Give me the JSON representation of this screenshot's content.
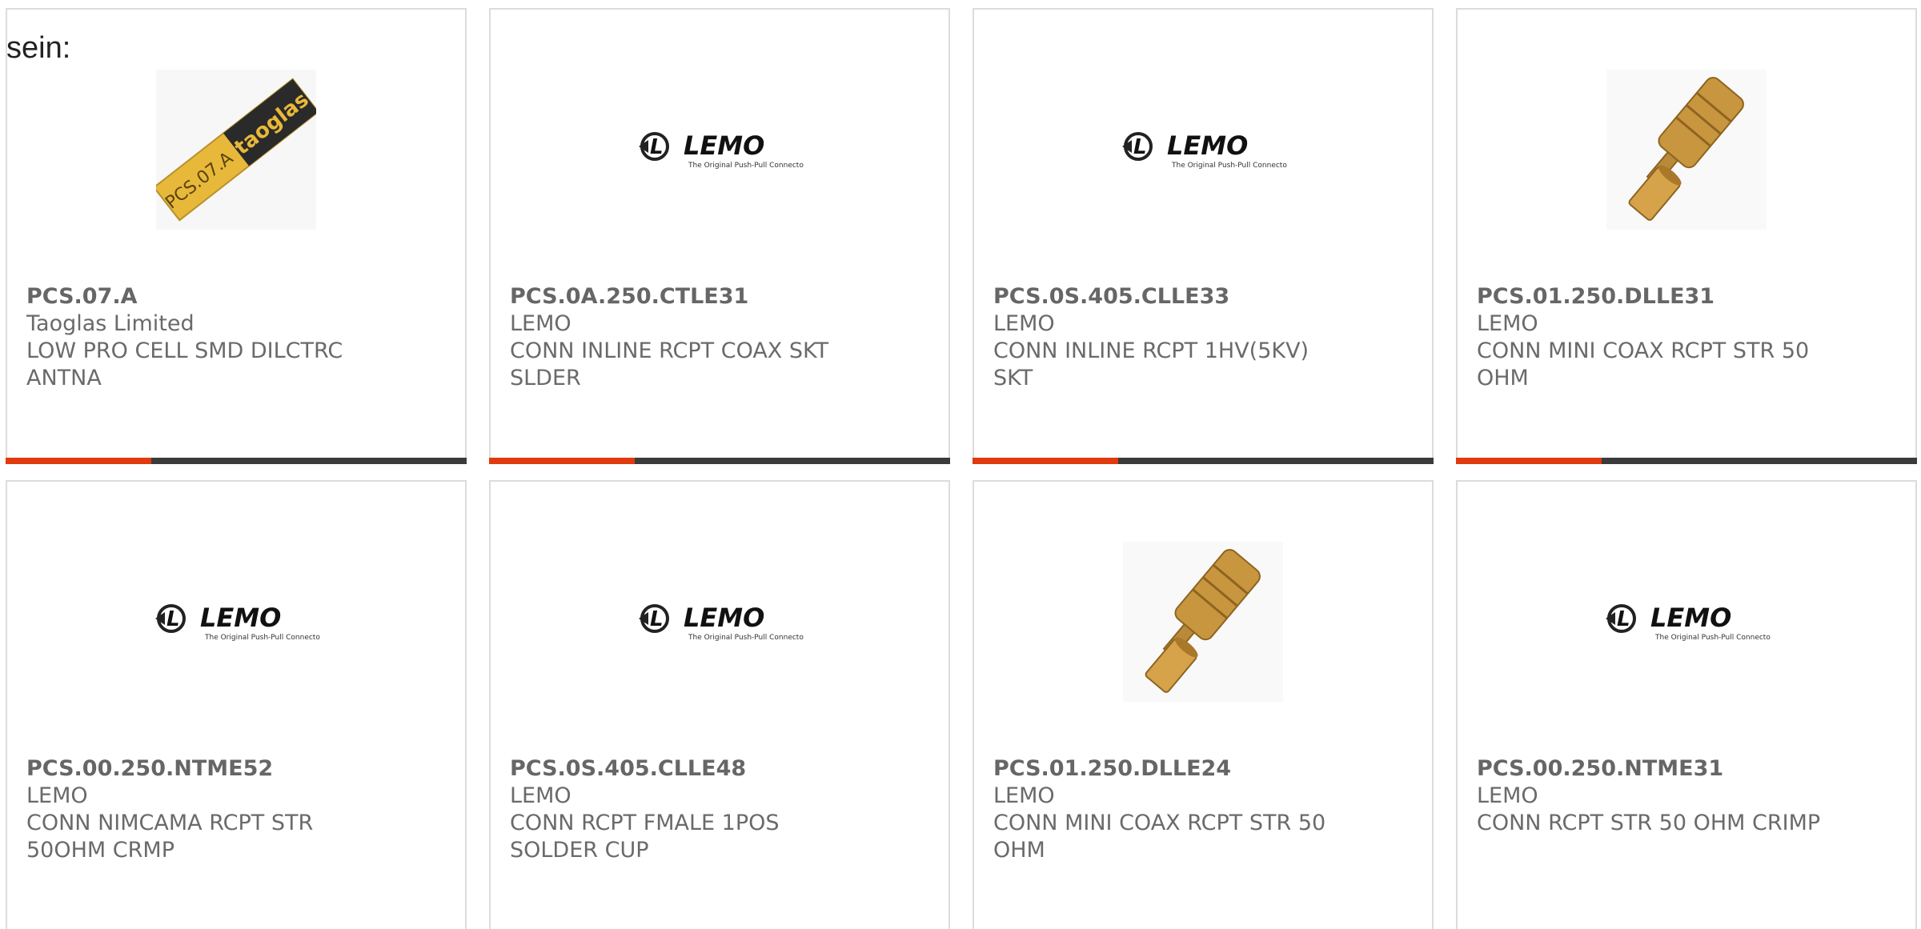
{
  "intro_text": "sein:",
  "colors": {
    "accent": "#e03a0e",
    "bar_dark": "#3b3b3b",
    "text_gray": "#6a6a6a",
    "card_border": "#dcdcdc"
  },
  "products": [
    {
      "part": "PCS.07.A",
      "maker": "Taoglas Limited",
      "desc1": "LOW PRO CELL SMD DILCTRC",
      "desc2": "ANTNA",
      "image": "taoglas-antenna-photo"
    },
    {
      "part": "PCS.0A.250.CTLE31",
      "maker": "LEMO",
      "desc1": "CONN INLINE RCPT COAX SKT",
      "desc2": "SLDER",
      "image": "lemo-logo"
    },
    {
      "part": "PCS.0S.405.CLLE33",
      "maker": "LEMO",
      "desc1": "CONN INLINE RCPT 1HV(5KV)",
      "desc2": "SKT",
      "image": "lemo-logo"
    },
    {
      "part": "PCS.01.250.DLLE31",
      "maker": "LEMO",
      "desc1": "CONN MINI COAX RCPT STR 50",
      "desc2": "OHM",
      "image": "gold-connector-photo"
    },
    {
      "part": "PCS.00.250.NTME52",
      "maker": "LEMO",
      "desc1": "CONN NIMCAMA RCPT STR",
      "desc2": "50OHM CRMP",
      "image": "lemo-logo"
    },
    {
      "part": "PCS.0S.405.CLLE48",
      "maker": "LEMO",
      "desc1": "CONN RCPT FMALE 1POS",
      "desc2": "SOLDER CUP",
      "image": "lemo-logo"
    },
    {
      "part": "PCS.01.250.DLLE24",
      "maker": "LEMO",
      "desc1": "CONN MINI COAX RCPT STR 50",
      "desc2": "OHM",
      "image": "gold-connector-photo"
    },
    {
      "part": "PCS.00.250.NTME31",
      "maker": "LEMO",
      "desc1": "CONN RCPT STR 50 OHM CRIMP",
      "desc2": "",
      "image": "lemo-logo"
    }
  ],
  "logo": {
    "lemo_word": "LEMO",
    "lemo_tagline": "The Original Push-Pull Connector",
    "taoglas_word": "taoglas",
    "taoglas_label": "PCS.07.A"
  }
}
